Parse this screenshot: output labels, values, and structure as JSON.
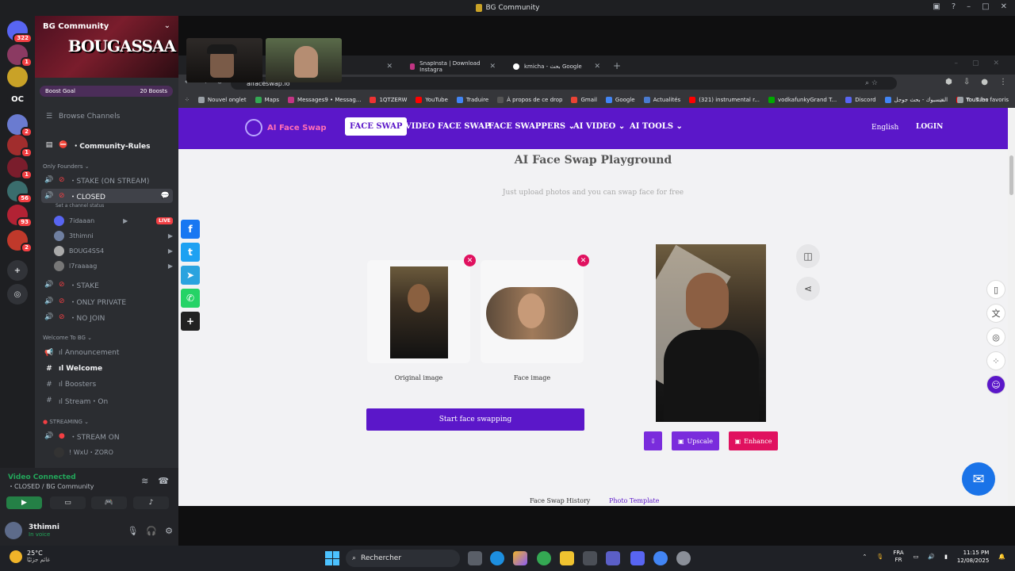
{
  "titlebar": {
    "title": "BG Community"
  },
  "rail": {
    "servers": [
      {
        "label": "",
        "badge": "322",
        "color": "#5865f2"
      },
      {
        "label": "",
        "badge": "1",
        "color": "#8b3a62"
      },
      {
        "label": "",
        "badge": "",
        "color": "#c9a227"
      },
      {
        "label": "OC",
        "badge": "",
        "color": "#1e1f22"
      },
      {
        "label": "",
        "badge": "2",
        "color": "#6a7bd0"
      },
      {
        "label": "",
        "badge": "1",
        "color": "#a12d2d"
      },
      {
        "label": "",
        "badge": "1",
        "color": "#7a1d2c"
      },
      {
        "label": "",
        "badge": "56",
        "color": "#3a6d6d"
      },
      {
        "label": "",
        "badge": "93",
        "color": "#b22234"
      },
      {
        "label": "",
        "badge": "2",
        "color": "#c0392b"
      }
    ]
  },
  "server": {
    "name": "BG Community",
    "banner_text": "BOUGASSAA",
    "boost_goal": "Boost Goal",
    "boosts": "20 Boosts"
  },
  "channels": {
    "browse": "Browse Channels",
    "rules": "・Community-Rules",
    "cat_founders": "Only Founders",
    "stake_stream": "・STAKE (ON STREAM)",
    "closed": "・CLOSED",
    "closed_status": "Set a channel status",
    "users": [
      {
        "name": "7idaaan",
        "live": "LIVE"
      },
      {
        "name": "3thimni"
      },
      {
        "name": "BOUG4SS4"
      },
      {
        "name": "l7raaaag"
      }
    ],
    "stake": "・STAKE",
    "only_private": "・ONLY PRIVATE",
    "no_join": "・NO JOIN",
    "cat_welcome": "Welcome To BG",
    "announcement": "ıl Announcement",
    "welcome": "ıl Welcome",
    "boosters": "ıl Boosters",
    "stream_on": "ıl Stream・On",
    "cat_streaming": "STREAMING",
    "stream_on_voice": "・STREAM ON",
    "streamer": "! WxU・ZORO"
  },
  "voice": {
    "status": "Video Connected",
    "location": "・CLOSED / BG Community"
  },
  "me": {
    "name": "3thimni",
    "status": "In voice"
  },
  "browser": {
    "tabs": [
      {
        "title": "SnapInsta | Download Instagra"
      },
      {
        "title": "kmicha - بحث Google"
      }
    ],
    "url": "aifaceswap.io",
    "bookmarks": [
      "Nouvel onglet",
      "Maps",
      "Messages9 • Messag...",
      "1QTZERW",
      "YouTube",
      "Traduire",
      "À propos de ce drop",
      "Gmail",
      "Google",
      "Actualités",
      "(321) instrumental r...",
      "vodkafunkyGrand T...",
      "Discord",
      "الفيسبوك - بحث جوجل",
      "YouTube"
    ],
    "all_bookmarks": "Tous les favoris"
  },
  "site": {
    "logo": "AI Face Swap",
    "nav": [
      "FACE SWAP",
      "VIDEO FACE SWAP",
      "FACE SWAPPERS",
      "AI VIDEO",
      "AI TOOLS"
    ],
    "lang": "English",
    "login": "LOGIN",
    "title": "AI Face Swap Playground",
    "subtitle": "Just upload photos and you can swap face for free",
    "original_label": "Original image",
    "face_label": "Face image",
    "start": "Start face swapping",
    "upscale": "Upscale",
    "enhance": "Enhance",
    "history": "Face Swap History",
    "template": "Photo Template"
  },
  "colors": {
    "purple": "#5b17c9",
    "pink": "#e0115f",
    "discord_green": "#23a55a"
  },
  "taskbar": {
    "temp": "25°C",
    "weather": "غائم جزئيًا",
    "search": "Rechercher",
    "lang1": "FRA",
    "lang2": "FR",
    "time": "11:15 PM",
    "date": "12/08/2025"
  }
}
